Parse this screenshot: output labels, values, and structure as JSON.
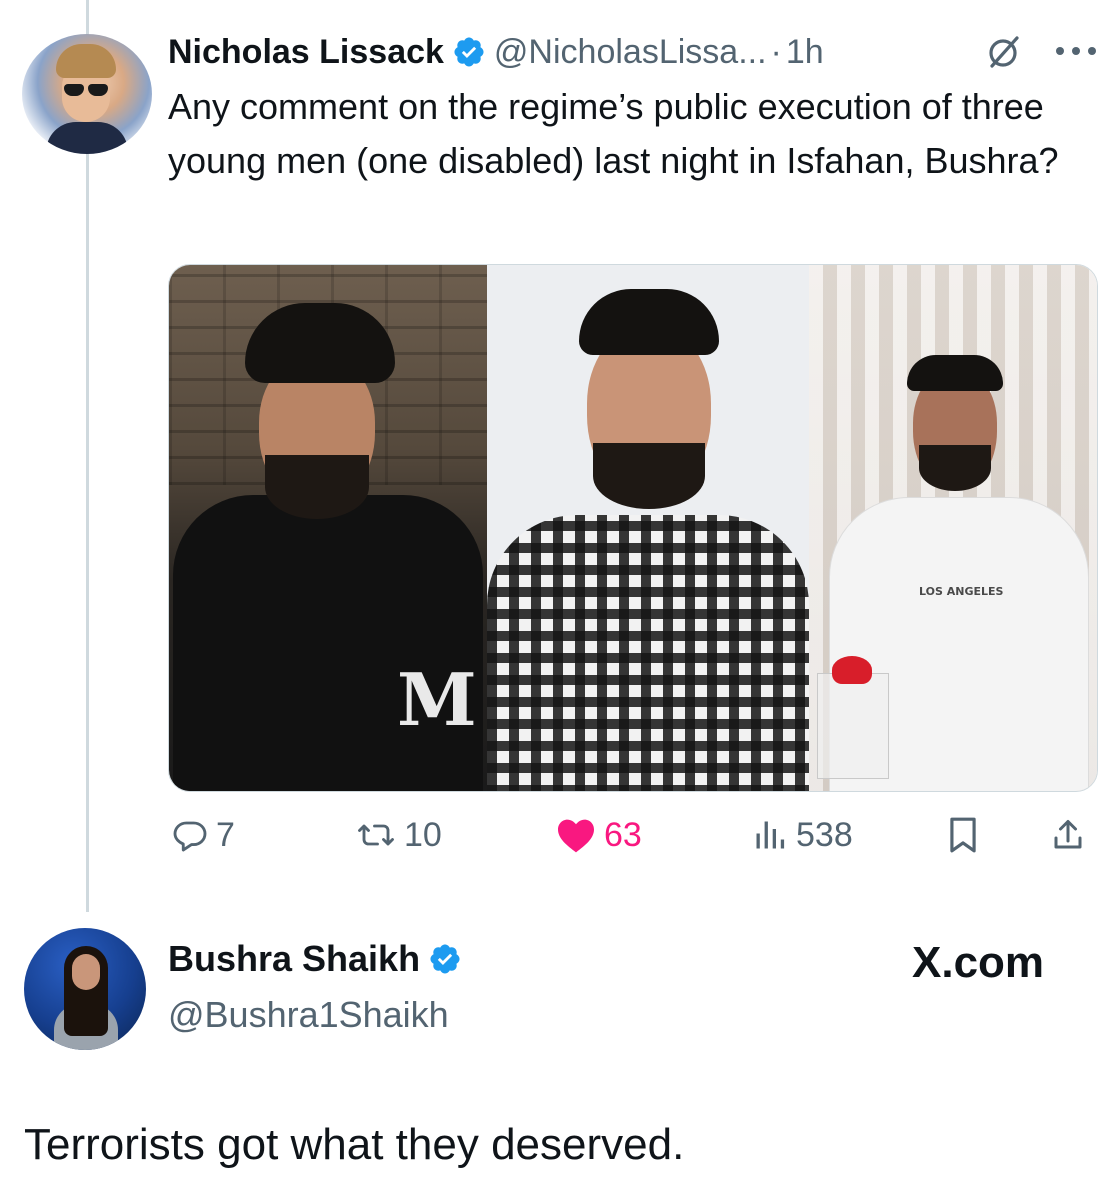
{
  "tweet": {
    "author_name": "Nicholas Lissack",
    "author_handle": "@NicholasLissa...",
    "separator": "·",
    "time": "1h",
    "text": "Any comment on the regime’s public execution of three young men (one disabled) last night in Isfahan, Bushra?",
    "media": {
      "photos": [
        {
          "shirt_text": "M"
        },
        {
          "shirt_text": ""
        },
        {
          "shirt_text": "LOS ANGELES"
        }
      ]
    },
    "actions": {
      "replies": "7",
      "reposts": "10",
      "likes": "63",
      "views": "538"
    },
    "colors": {
      "verified": "#1d9bf0",
      "like": "#f91880",
      "muted": "#536471",
      "thread_line": "#cfd9de"
    },
    "icons": [
      "verified-badge-icon",
      "grok-icon",
      "more-icon",
      "reply-icon",
      "repost-icon",
      "heart-icon",
      "views-icon",
      "bookmark-icon",
      "share-icon"
    ]
  },
  "reply": {
    "author_name": "Bushra Shaikh",
    "author_handle": "@Bushra1Shaikh",
    "site": "X.com",
    "text": "Terrorists got what they deserved."
  }
}
